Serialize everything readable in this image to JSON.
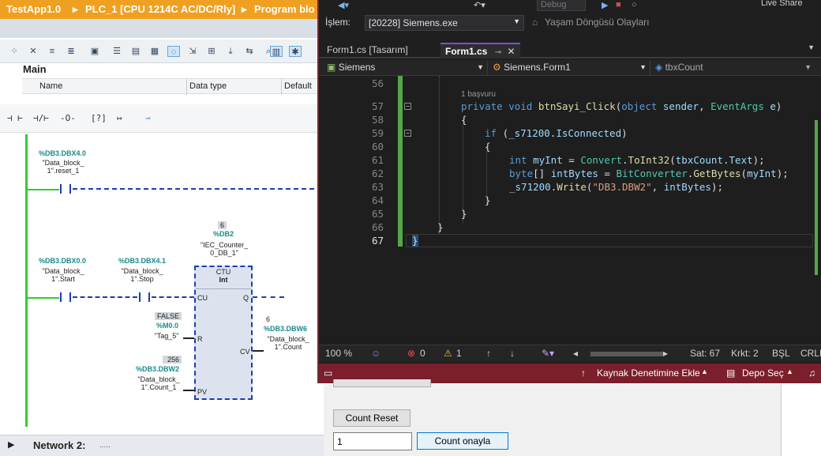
{
  "tia": {
    "title_parts": [
      "TestApp1.0",
      "▸",
      "PLC_1 [CPU 1214C AC/DC/Rly]",
      "▸",
      "Program blo"
    ],
    "block_name": "Main",
    "columns": [
      "Name",
      "Data type",
      "Default"
    ],
    "network2_label": "Network 2:",
    "network2_comment": ".....",
    "rung1": {
      "address": "%DB3.DBX4.0",
      "tag": "\"Data_block_\n1\".reset_1"
    },
    "start_contact": {
      "address": "%DB3.DBX0.0",
      "tag": "\"Data_block_\n1\".Start"
    },
    "stop_contact": {
      "address": "%DB3.DBX4.1",
      "tag": "\"Data_block_\n1\".Stop"
    },
    "counter": {
      "db_value": "6",
      "db_address": "%DB2",
      "instance": "\"IEC_Counter_\n0_DB_1\"",
      "type": "CTU",
      "datatype": "Int",
      "pins": [
        "CU",
        "Q",
        "R",
        "CV",
        "PV"
      ]
    },
    "reset_input": {
      "value": "FALSE",
      "address": "%M0.0",
      "tag": "\"Tag_5\""
    },
    "pv_input": {
      "value": "256",
      "address": "%DB3.DBW2",
      "tag": "\"Data_block_\n1\".Count_1"
    },
    "cv_output": {
      "value": "6",
      "address": "%DB3.DBW6",
      "tag": "\"Data_block_\n1\".Count"
    }
  },
  "vs": {
    "top_labels": [
      "Debug",
      "Live Share"
    ],
    "process_label": "İşlem:",
    "process_value": "[20228] Siemens.exe",
    "lifecycle_label": "Yaşam Döngüsü Olayları",
    "tabs": [
      "Form1.cs [Tasarım]",
      "Form1.cs"
    ],
    "nav": [
      "Siemens",
      "Siemens.Form1",
      "tbxCount"
    ],
    "codelens": "1 başvuru",
    "lines": [
      "56",
      "57",
      "58",
      "59",
      "60",
      "61",
      "62",
      "63",
      "64",
      "65",
      "66",
      "67"
    ],
    "status": {
      "zoom": "100 %",
      "errors": "0",
      "warnings": "1",
      "line": "Sat: 67",
      "col": "Krkt: 2",
      "ws": "BŞL",
      "eol": "CRLF"
    },
    "git": {
      "add_source_control": "Kaynak Denetimine Ekle",
      "select_repo": "Depo Seç"
    }
  },
  "form": {
    "reset_button": "Count Reset",
    "confirm_button": "Count onayla",
    "count_value": "1"
  }
}
